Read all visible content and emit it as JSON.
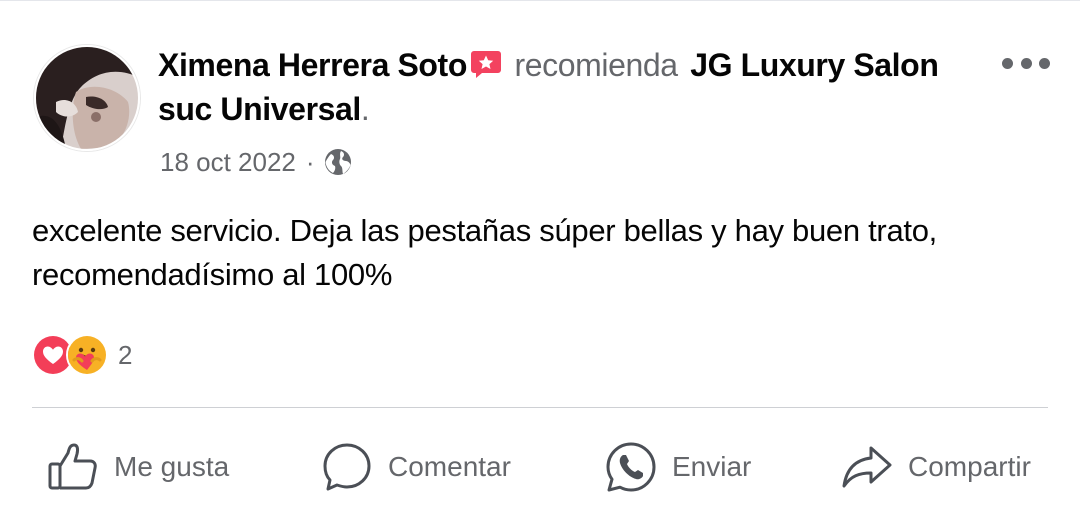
{
  "post": {
    "author": "Ximena Herrera Soto",
    "verb": "recomienda",
    "page_name": "JG Luxury Salon suc Universal",
    "period": ".",
    "date": "18 oct 2022",
    "separator": "·",
    "privacy_icon": "globe-icon",
    "text_line1": "excelente servicio. Deja las pestañas súper bellas y hay buen trato,",
    "text_line2": "recomendadísimo al 100%"
  },
  "reactions": {
    "types": [
      "love",
      "care"
    ],
    "count": "2"
  },
  "actions": {
    "like": "Me gusta",
    "comment": "Comentar",
    "send": "Enviar",
    "share": "Compartir"
  },
  "colors": {
    "text_primary": "#050505",
    "text_secondary": "#65676b",
    "love_red": "#f33e58",
    "care_yellow": "#f7b125",
    "recommend_badge": "#f3425f",
    "divider": "#ced0d4"
  }
}
